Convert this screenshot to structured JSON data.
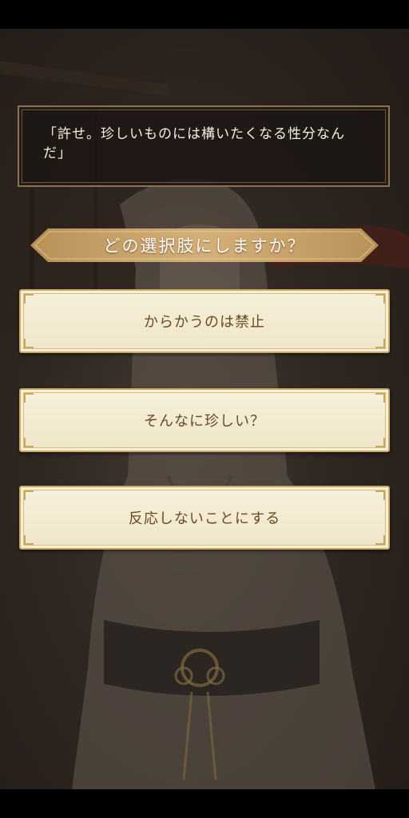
{
  "dialogue": {
    "text": "「許せ。珍しいものには構いたくなる性分なんだ」"
  },
  "prompt": {
    "text": "どの選択肢にしますか？"
  },
  "choices": [
    {
      "label": "からかうのは禁止"
    },
    {
      "label": "そんなに珍しい？"
    },
    {
      "label": "反応しないことにする"
    }
  ],
  "colors": {
    "banner": "#c8a46a",
    "choice_bg": "#f6f0da",
    "choice_text": "#6a4a26",
    "dialogue_border": "#8a7350"
  }
}
